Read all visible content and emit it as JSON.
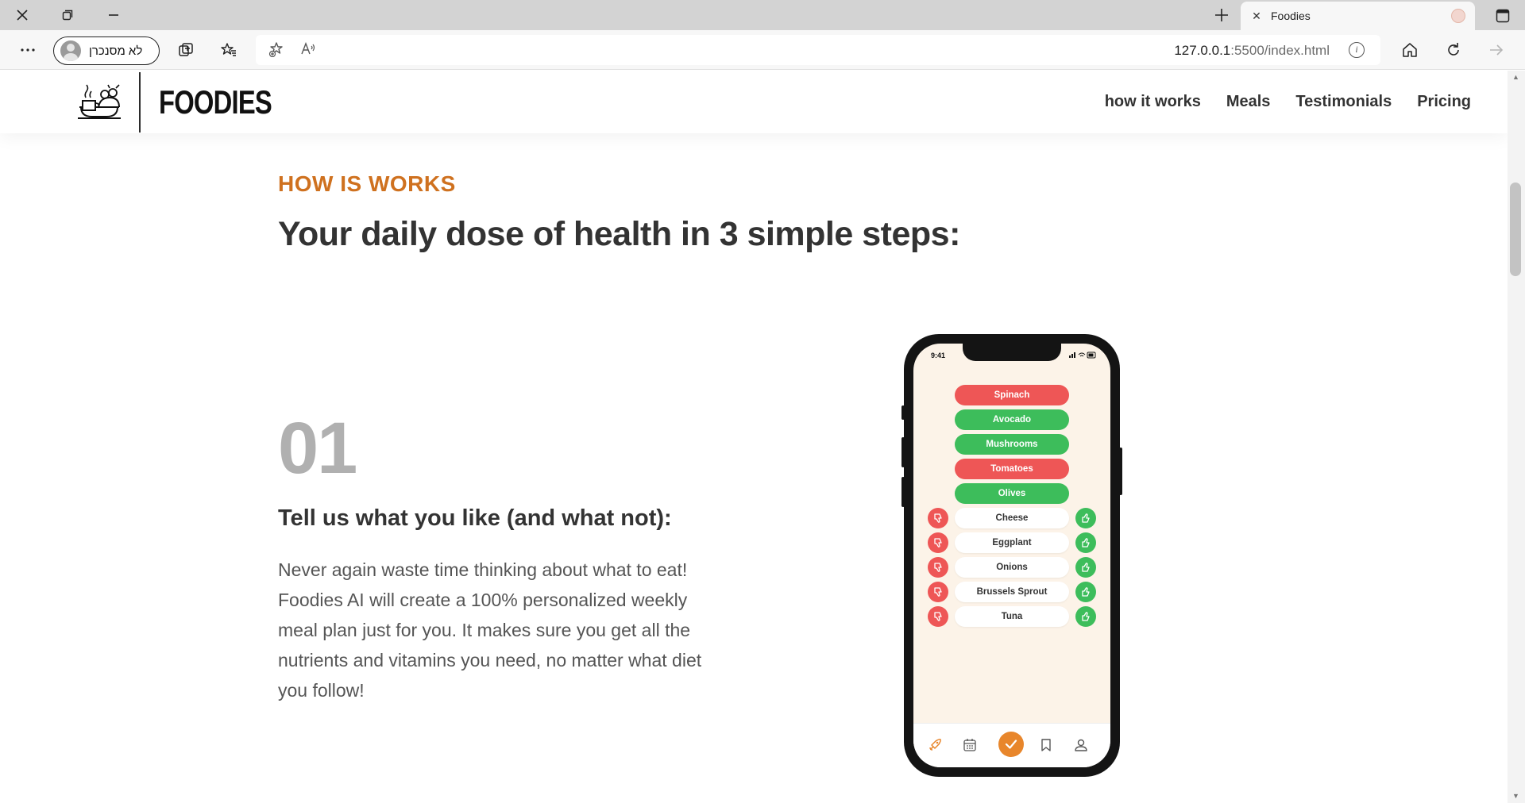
{
  "browser": {
    "tab_title": "Foodies",
    "profile_label": "לא מסנכרן",
    "url_host": "127.0.0.1",
    "url_rest": ":5500/index.html"
  },
  "site": {
    "logo_text": "FOODIES",
    "nav": [
      "how it works",
      "Meals",
      "Testimonials",
      "Pricing"
    ]
  },
  "section": {
    "eyebrow": "HOW IS WORKS",
    "headline": "Your daily dose of health in 3 simple steps:"
  },
  "step": {
    "number": "01",
    "title": "Tell us what you like (and what not):",
    "text": "Never again waste time thinking about what to eat! Foodies AI will create a 100% personalized weekly meal plan just for you. It makes sure you get all the nutrients and vitamins you need, no matter what diet you follow!"
  },
  "phone": {
    "time": "9:41",
    "rated_items": [
      {
        "label": "Spinach",
        "state": "disliked"
      },
      {
        "label": "Avocado",
        "state": "liked"
      },
      {
        "label": "Mushrooms",
        "state": "liked"
      },
      {
        "label": "Tomatoes",
        "state": "disliked"
      },
      {
        "label": "Olives",
        "state": "liked"
      }
    ],
    "unrated_items": [
      "Cheese",
      "Eggplant",
      "Onions",
      "Brussels Sprout",
      "Tuna"
    ],
    "tabs": [
      "rocket-icon",
      "calendar-icon",
      "check-icon",
      "bookmark-icon",
      "user-icon"
    ]
  },
  "colors": {
    "accent": "#cf711f",
    "like": "#3dbd5b",
    "dislike": "#ee5656",
    "phone_screen": "#fcf3e8"
  }
}
